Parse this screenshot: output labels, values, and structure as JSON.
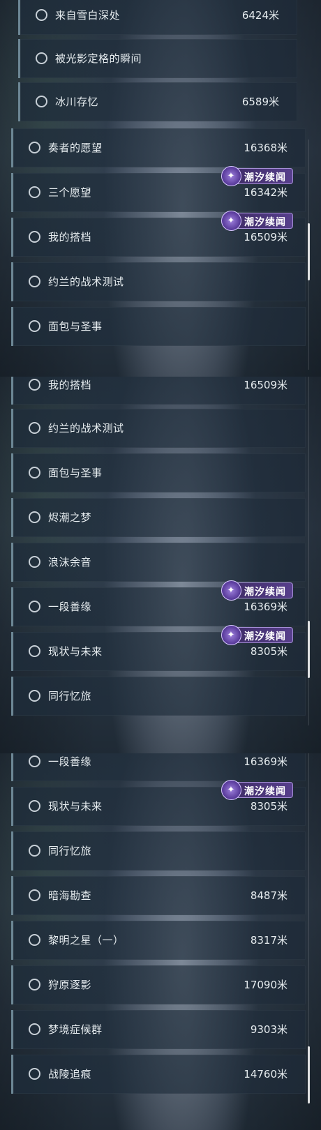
{
  "panels": [
    {
      "rows": [
        {
          "title": "来自雪白深处",
          "distance": "6424米",
          "badge": null
        },
        {
          "title": "被光影定格的瞬间",
          "distance": "",
          "badge": null
        },
        {
          "title": "冰川存忆",
          "distance": "6589米",
          "badge": null
        },
        {
          "title": "奏者的愿望",
          "distance": "16368米",
          "badge": null
        },
        {
          "title": "三个愿望",
          "distance": "16342米",
          "badge": "潮汐续闻"
        },
        {
          "title": "我的搭档",
          "distance": "16509米",
          "badge": "潮汐续闻"
        },
        {
          "title": "约兰的战术测试",
          "distance": "",
          "badge": null
        },
        {
          "title": "面包与圣事",
          "distance": "",
          "badge": null
        }
      ]
    },
    {
      "rows": [
        {
          "title": "我的搭档",
          "distance": "16509米",
          "badge": null
        },
        {
          "title": "约兰的战术测试",
          "distance": "",
          "badge": null
        },
        {
          "title": "面包与圣事",
          "distance": "",
          "badge": null
        },
        {
          "title": "烬潮之梦",
          "distance": "",
          "badge": null
        },
        {
          "title": "浪沫余音",
          "distance": "",
          "badge": null
        },
        {
          "title": "一段善缘",
          "distance": "16369米",
          "badge": "潮汐续闻"
        },
        {
          "title": "现状与未来",
          "distance": "8305米",
          "badge": "潮汐续闻"
        },
        {
          "title": "同行忆旅",
          "distance": "",
          "badge": null
        }
      ]
    },
    {
      "rows": [
        {
          "title": "一段善缘",
          "distance": "16369米",
          "badge": null
        },
        {
          "title": "现状与未来",
          "distance": "8305米",
          "badge": "潮汐续闻"
        },
        {
          "title": "同行忆旅",
          "distance": "",
          "badge": null
        },
        {
          "title": "暗海勘查",
          "distance": "8487米",
          "badge": null
        },
        {
          "title": "黎明之星（一）",
          "distance": "8317米",
          "badge": null
        },
        {
          "title": "狩原逐影",
          "distance": "17090米",
          "badge": null
        },
        {
          "title": "梦境症候群",
          "distance": "9303米",
          "badge": null
        },
        {
          "title": "战陵追痕",
          "distance": "14760米",
          "badge": null
        }
      ]
    }
  ],
  "icons": {
    "row_status": "circle-outline-icon",
    "badge_emblem": "tide-emblem-icon"
  },
  "colors": {
    "badge": "#573f8c",
    "row_accent": "#6c8694",
    "text": "#e6ecef"
  }
}
